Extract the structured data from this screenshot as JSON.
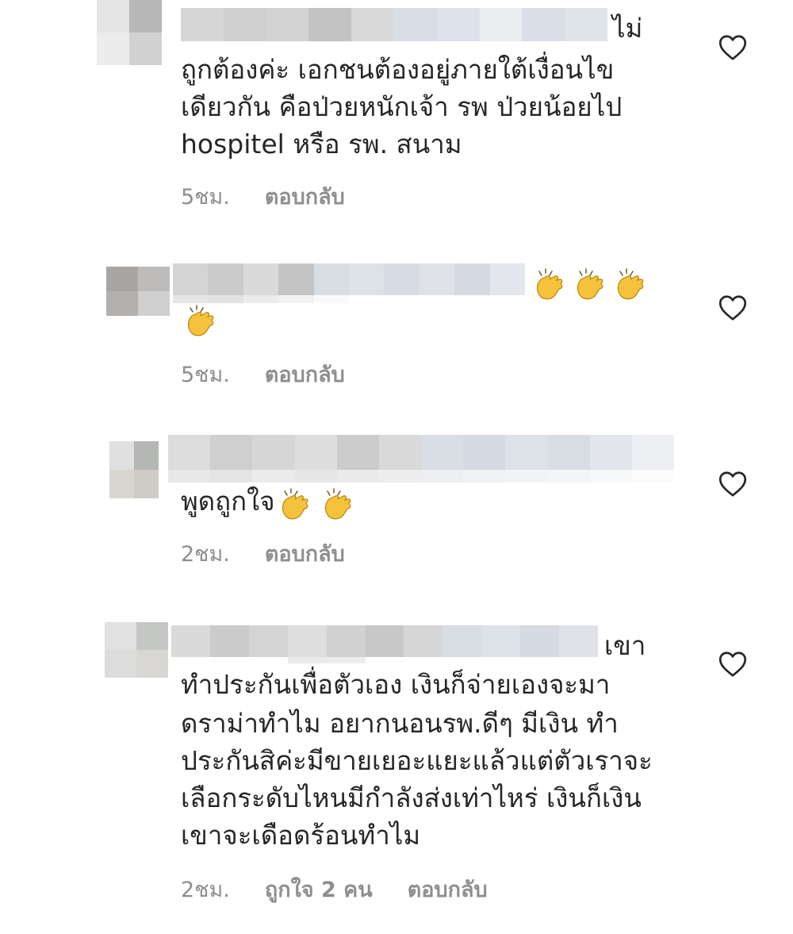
{
  "comments": [
    {
      "lines": [
        "ไม่",
        "ถูกต้องค่ะ เอกชนต้องอยู่ภายใต้เงื่อนไข",
        "เดียวกัน คือป่วยหนักเจ้า รพ ป่วยน้อยไป",
        "hospitel หรือ รพ. สนาม"
      ],
      "time": "5ชม.",
      "reply": "ตอบกลับ"
    },
    {
      "text": "",
      "time": "5ชม.",
      "reply": "ตอบกลับ"
    },
    {
      "text": "พูดถูกใจ",
      "time": "2ชม.",
      "reply": "ตอบกลับ"
    },
    {
      "lines": [
        "เขา",
        "ทำประกันเพื่อตัวเอง เงินก็จ่ายเองจะมา",
        "ดราม่าทำไม อยากนอนรพ.ดีๆ  มีเงิน ทำ",
        "ประกันสิค่ะมีขายเยอะแยะแล้วแต่ตัวเราจะ",
        "เลือกระดับไหนมีกำลังส่งเท่าไหร่ เงินก็เงิน",
        "เขาจะเดือดร้อนทำไม"
      ],
      "time": "2ชม.",
      "likes": "ถูกใจ 2 คน",
      "reply": "ตอบกลับ"
    }
  ],
  "icons": {
    "like": "heart-outline-icon",
    "emoji": "clapping-hands-emoji"
  },
  "colors": {
    "text": "#262626",
    "meta": "#8e8e8e",
    "clap": "#f5c33b"
  }
}
